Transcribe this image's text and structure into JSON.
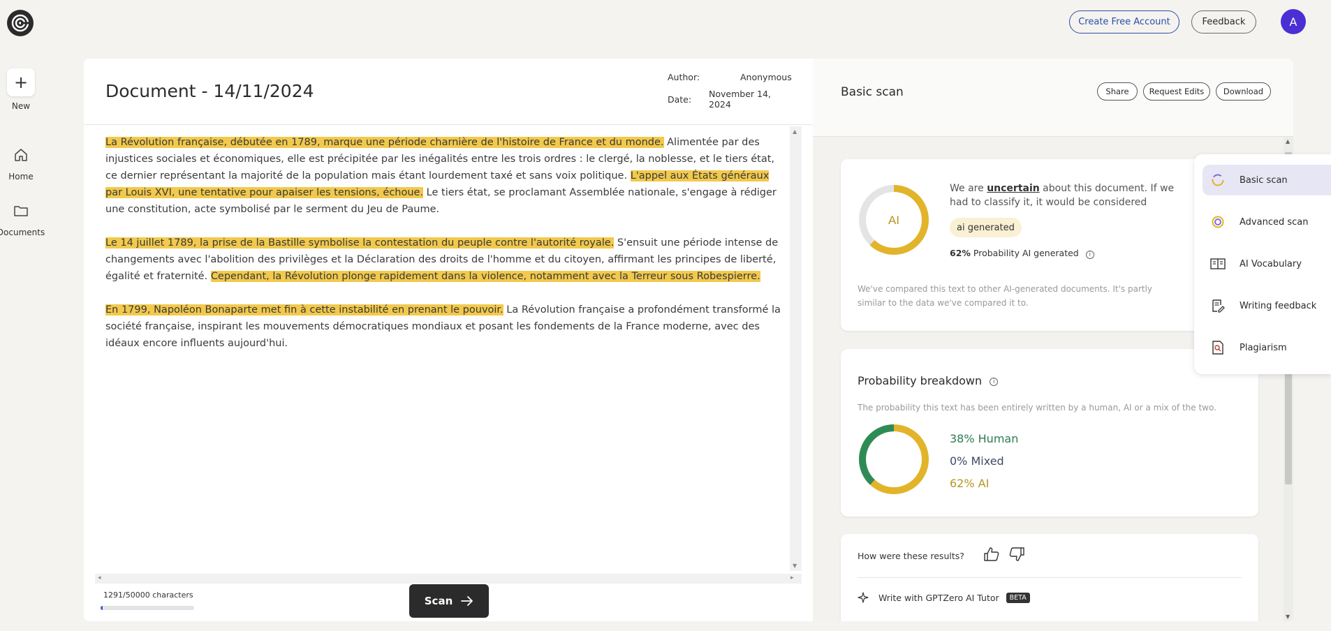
{
  "topbar": {
    "create_account": "Create Free Account",
    "feedback": "Feedback",
    "avatar_letter": "A"
  },
  "nav": {
    "new_label": "New",
    "new_icon": "plus-icon",
    "home_label": "Home",
    "documents_label": "Documents"
  },
  "document": {
    "title": "Document - 14/11/2024",
    "author_label": "Author:",
    "author_value": "Anonymous",
    "date_label": "Date:",
    "date_value_line1": "November 14,",
    "date_value_line2": "2024",
    "paragraphs": [
      [
        {
          "text": "La Révolution française, débutée en 1789, marque une période charnière de l'histoire de France et du monde.",
          "hl": true
        },
        {
          "text": " Alimentée par des injustices sociales et économiques, elle est précipitée par les inégalités entre les trois ordres : le clergé, la noblesse, et le tiers état, ce dernier représentant la majorité de la population mais étant lourdement taxé et sans voix politique. ",
          "hl": false
        },
        {
          "text": "L'appel aux États généraux par Louis XVI, une tentative pour apaiser les tensions, échoue.",
          "hl": true
        },
        {
          "text": " Le tiers état, se proclamant Assemblée nationale, s'engage à rédiger une constitution, acte symbolisé par le serment du Jeu de Paume.",
          "hl": false
        }
      ],
      [
        {
          "text": "Le 14 juillet 1789, la prise de la Bastille symbolise la contestation du peuple contre l'autorité royale.",
          "hl": true
        },
        {
          "text": " S'ensuit une période intense de changements avec l'abolition des privilèges et la Déclaration des droits de l'homme et du citoyen, affirmant les principes de liberté, égalité et fraternité. ",
          "hl": false
        },
        {
          "text": "Cependant, la Révolution plonge rapidement dans la violence, notamment avec la Terreur sous Robespierre.",
          "hl": true
        }
      ],
      [
        {
          "text": "En 1799, Napoléon Bonaparte met fin à cette instabilité en prenant le pouvoir.",
          "hl": true
        },
        {
          "text": " La Révolution française a profondément transformé la société française, inspirant les mouvements démocratiques mondiaux et posant les fondements de la France moderne, avec des idéaux encore influents aujourd'hui.",
          "hl": false
        }
      ]
    ],
    "char_count": "1291/50000 characters",
    "char_fraction": 0.026,
    "scan_button": "Scan"
  },
  "scan": {
    "title": "Basic scan",
    "share": "Share",
    "request_edits": "Request Edits",
    "download": "Download",
    "donut_label": "AI",
    "verdict_prefix": "We are ",
    "verdict_word": "uncertain",
    "verdict_suffix": " about this document. If we had to classify it, it would be considered",
    "classification": "ai generated",
    "prob_value": "62%",
    "prob_label": " Probability AI generated",
    "ai_fraction": 0.62,
    "compare_text": "We've compared this text to other AI-generated documents. It's partly similar to the data we've compared it to.",
    "breakdown_title": "Probability breakdown",
    "breakdown_desc": "The probability this text has been entirely written by a human, AI or a mix of the two.",
    "human_label": "38% Human",
    "mixed_label": "0% Mixed",
    "ai_label": "62% AI",
    "human_fraction": 0.38,
    "mixed_fraction": 0.0,
    "feedback_question": "How were these results?",
    "tutor_label": "Write with GPTZero AI Tutor",
    "beta": "BETA"
  },
  "menu": {
    "items": [
      "Basic scan",
      "Advanced scan",
      "AI Vocabulary",
      "Writing feedback",
      "Plagiarism"
    ]
  },
  "colors": {
    "highlight": "#f2c94c",
    "accent": "#2c4ea8",
    "avatar": "#4a2fd4",
    "human": "#2e8b57",
    "ai": "#e2b429",
    "mixed": "#3f4a63"
  }
}
